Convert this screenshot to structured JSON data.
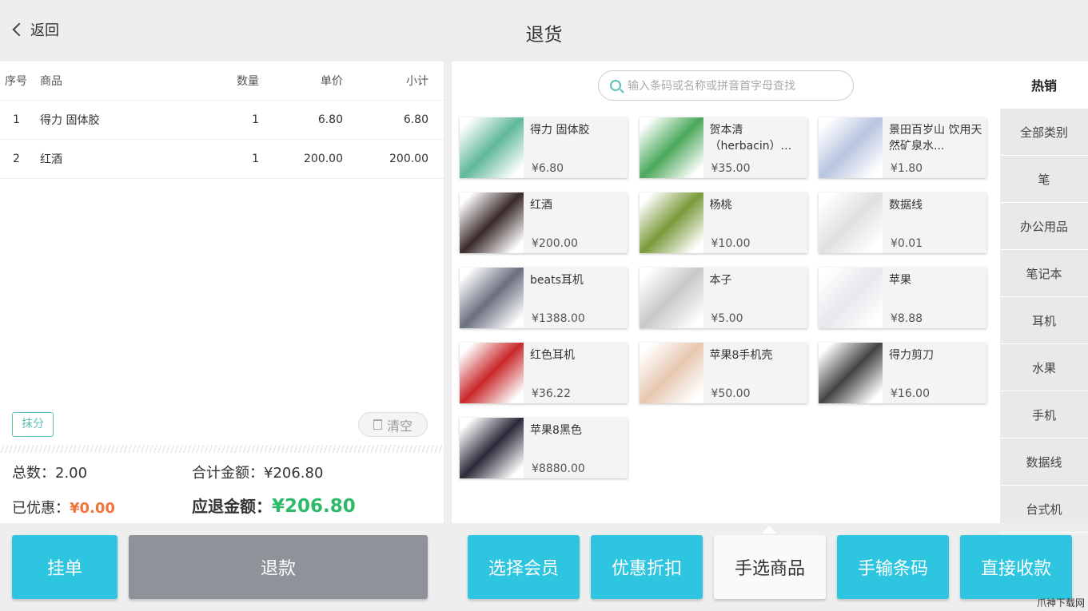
{
  "header": {
    "back_label": "返回",
    "title": "退货"
  },
  "table": {
    "headers": [
      "序号",
      "商品",
      "数量",
      "单价",
      "小计"
    ],
    "rows": [
      [
        "1",
        "得力 固体胶",
        "1",
        "6.80",
        "6.80"
      ],
      [
        "2",
        "红酒",
        "1",
        "200.00",
        "200.00"
      ]
    ]
  },
  "mofen_label": "抹分",
  "clear_label": "清空",
  "summary": {
    "count_label": "总数：",
    "count": "2.00",
    "total_label": "合计金额：",
    "total": "¥206.80",
    "discount_label": "已优惠：",
    "discount": "¥0.00",
    "refund_label": "应退金额：",
    "refund": "¥206.80"
  },
  "buttons": {
    "hold": "挂单",
    "refund": "退款",
    "member": "选择会员",
    "discount": "优惠折扣",
    "manual": "手选商品",
    "barcode": "手输条码",
    "direct": "直接收款"
  },
  "search": {
    "placeholder": "输入条码或名称或拼音首字母查找"
  },
  "products": [
    {
      "name": "得力 固体胶",
      "price": "¥6.80",
      "color": "#5fb89a"
    },
    {
      "name": "贺本清（herbacin）...",
      "price": "¥35.00",
      "color": "#4aa85a"
    },
    {
      "name": "景田百岁山 饮用天然矿泉水...",
      "price": "¥1.80",
      "color": "#b8c4e0"
    },
    {
      "name": "红酒",
      "price": "¥200.00",
      "color": "#3a2a2a"
    },
    {
      "name": "杨桃",
      "price": "¥10.00",
      "color": "#7a9a3a"
    },
    {
      "name": "数据线",
      "price": "¥0.01",
      "color": "#e0e0e0"
    },
    {
      "name": "beats耳机",
      "price": "¥1388.00",
      "color": "#6a6f80"
    },
    {
      "name": "本子",
      "price": "¥5.00",
      "color": "#c8c8c8"
    },
    {
      "name": "苹果",
      "price": "¥8.88",
      "color": "#e6e8ec"
    },
    {
      "name": "红色耳机",
      "price": "¥36.22",
      "color": "#c8282a"
    },
    {
      "name": "苹果8手机壳",
      "price": "¥50.00",
      "color": "#e8c8b0"
    },
    {
      "name": "得力剪刀",
      "price": "¥16.00",
      "color": "#444444"
    },
    {
      "name": "苹果8黑色",
      "price": "¥8880.00",
      "color": "#2a2a3a"
    }
  ],
  "categories": [
    "热销",
    "全部类别",
    "笔",
    "办公用品",
    "笔记本",
    "耳机",
    "水果",
    "手机",
    "数据线",
    "台式机"
  ],
  "watermark": "爪神下载网"
}
